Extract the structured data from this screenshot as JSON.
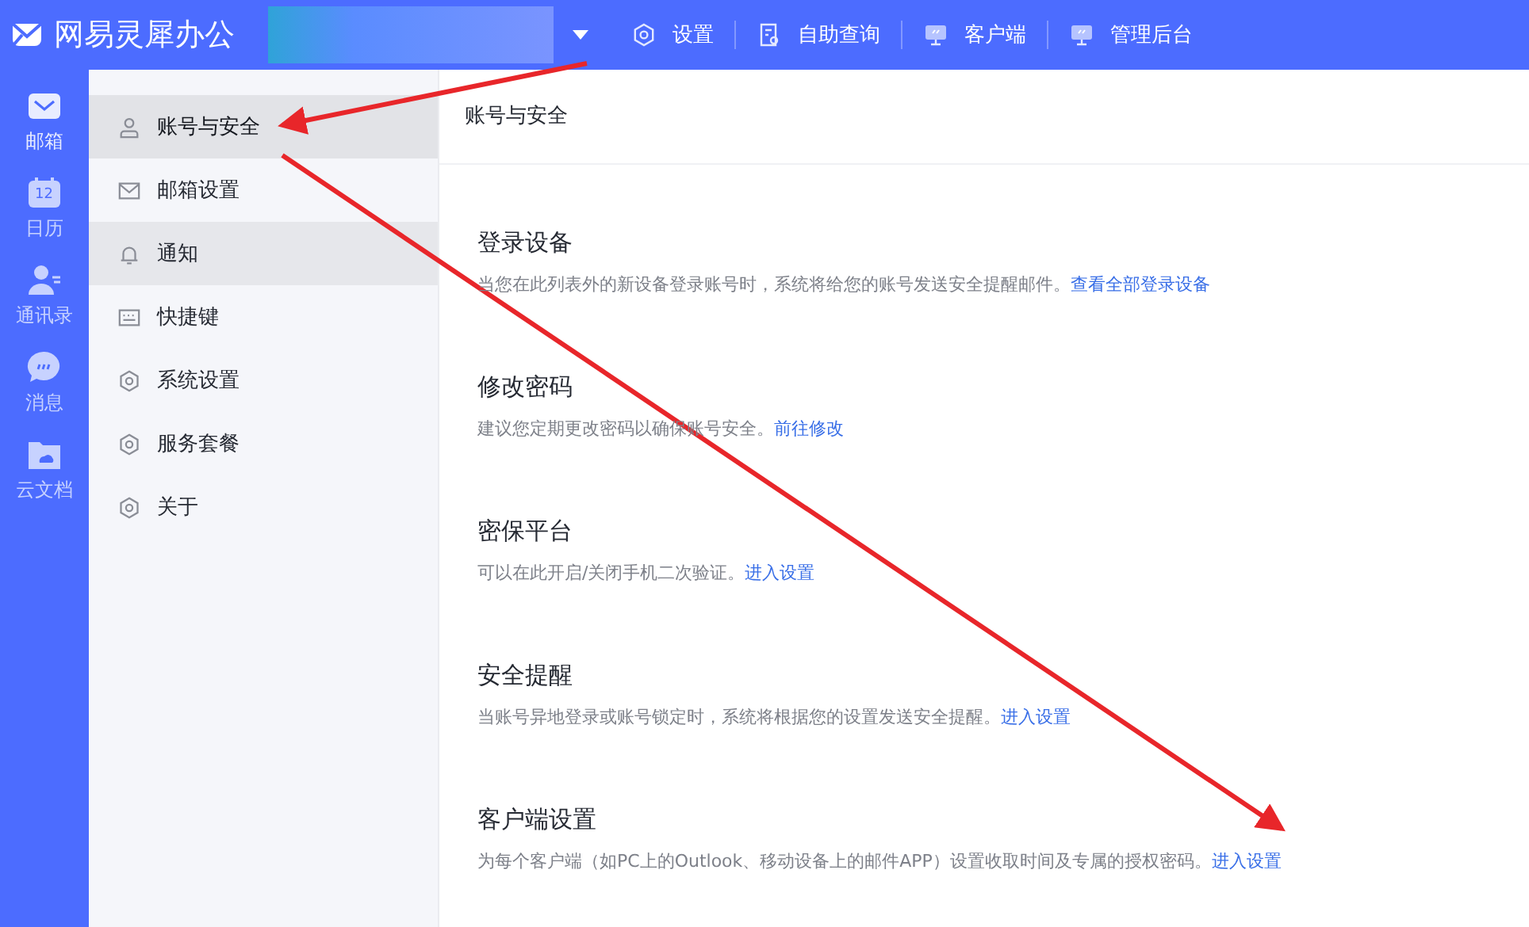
{
  "app": {
    "name": "网易灵犀办公"
  },
  "top_nav": [
    {
      "label": "设置"
    },
    {
      "label": "自助查询"
    },
    {
      "label": "客户端"
    },
    {
      "label": "管理后台"
    }
  ],
  "rail": [
    {
      "label": "邮箱",
      "selected": true
    },
    {
      "label": "日历",
      "selected": false
    },
    {
      "label": "通讯录",
      "selected": false
    },
    {
      "label": "消息",
      "selected": false
    },
    {
      "label": "云文档",
      "selected": false
    }
  ],
  "calendar_day": "12",
  "sidebar": {
    "items": [
      {
        "label": "账号与安全",
        "selected": true,
        "hovered": false
      },
      {
        "label": "邮箱设置",
        "selected": false,
        "hovered": false
      },
      {
        "label": "通知",
        "selected": false,
        "hovered": true
      },
      {
        "label": "快捷键",
        "selected": false,
        "hovered": false
      },
      {
        "label": "系统设置",
        "selected": false,
        "hovered": false
      },
      {
        "label": "服务套餐",
        "selected": false,
        "hovered": false
      },
      {
        "label": "关于",
        "selected": false,
        "hovered": false
      }
    ]
  },
  "page": {
    "title": "账号与安全",
    "sections": [
      {
        "title": "登录设备",
        "description": "当您在此列表外的新设备登录账号时，系统将给您的账号发送安全提醒邮件。",
        "link": "查看全部登录设备"
      },
      {
        "title": "修改密码",
        "description": "建议您定期更改密码以确保账号安全。",
        "link": "前往修改"
      },
      {
        "title": "密保平台",
        "description": "可以在此开启/关闭手机二次验证。",
        "link": "进入设置"
      },
      {
        "title": "安全提醒",
        "description": "当账号异地登录或账号锁定时，系统将根据您的设置发送安全提醒。",
        "link": "进入设置"
      },
      {
        "title": "客户端设置",
        "description": "为每个客户端（如PC上的Outlook、移动设备上的邮件APP）设置收取时间及专属的授权密码。",
        "link": "进入设置"
      }
    ]
  }
}
